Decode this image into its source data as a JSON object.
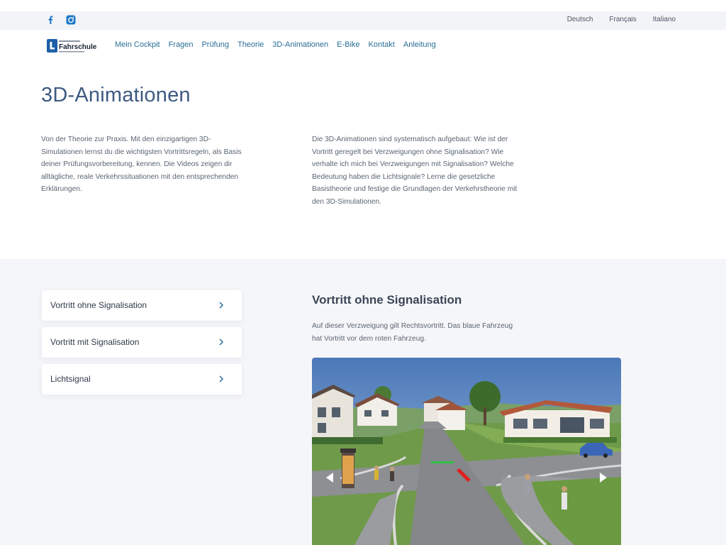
{
  "topbar": {
    "social": [
      "facebook-icon",
      "instagram-icon"
    ],
    "languages": [
      "Deutsch",
      "Français",
      "Italiano"
    ]
  },
  "nav": {
    "logo_text": "Fahrschule",
    "items": [
      "Mein Cockpit",
      "Fragen",
      "Prüfung",
      "Theorie",
      "3D-Animationen",
      "E-Bike",
      "Kontakt",
      "Anleitung"
    ],
    "active": "3D-Animationen"
  },
  "page": {
    "title": "3D-Animationen",
    "intro_left": "Von der Theorie zur Praxis. Mit den einzigartigen 3D-Simulationen lernst du die wichtigsten Vortrittsregeln, als Basis deiner Prüfungsvorbereitung, kennen. Die Videos zeigen dir alltägliche, reale Verkehrssituationen mit den entsprechenden Erklärungen.",
    "intro_right": "Die 3D-Animationen sind systematisch aufgebaut: Wie ist der Vortritt geregelt bei Verzweigungen ohne Signalisation? Wie verhalte ich mich bei Verzweigungen mit Signalisation? Welche Bedeutung haben die Lichtsignale? Lerne die gesetzliche Basistheorie und festige die Grundlagen der Verkehrstheorie mit den 3D-Simulationen."
  },
  "topics": {
    "items": [
      "Vortritt ohne Signalisation",
      "Vortritt mit Signalisation",
      "Lichtsignal"
    ]
  },
  "detail": {
    "title": "Vortritt ohne Signalisation",
    "description": "Auf dieser Verzweigung gilt Rechtsvortritt. Das blaue Fahrzeug hat Vortritt vor dem roten Fahrzeug."
  },
  "colors": {
    "title": "#3e5a82",
    "nav_link": "#2a6f97",
    "social_icon": "#1d78c5",
    "logo_blue": "#1d5fa8"
  }
}
